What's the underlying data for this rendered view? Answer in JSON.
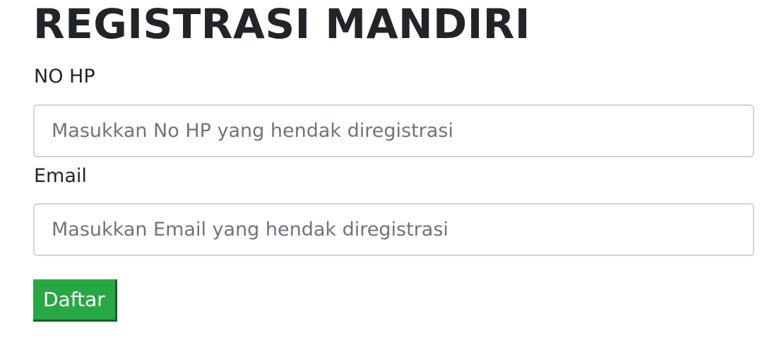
{
  "page": {
    "title": "REGISTRASI MANDIRI"
  },
  "form": {
    "phone": {
      "label": "NO HP",
      "value": "",
      "placeholder": "Masukkan No HP yang hendak diregistrasi"
    },
    "email": {
      "label": "Email",
      "value": "",
      "placeholder": "Masukkan Email yang hendak diregistrasi"
    },
    "submit_label": "Daftar"
  },
  "colors": {
    "text": "#212529",
    "placeholder": "#6c757d",
    "input_border": "#ced4da",
    "button_bg": "#28a745",
    "button_text": "#ffffff",
    "background": "#ffffff"
  }
}
